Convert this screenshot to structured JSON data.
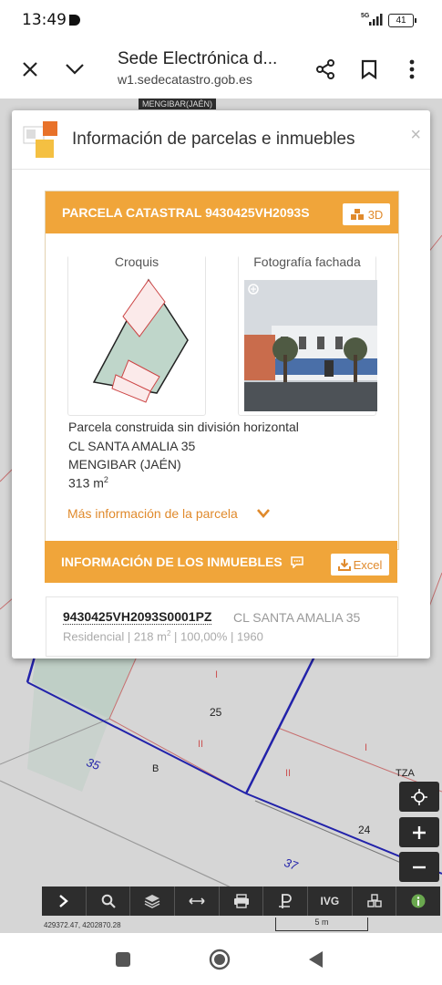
{
  "status_bar": {
    "time": "13:49",
    "network": "5G",
    "battery": "41"
  },
  "browser": {
    "title": "Sede Electrónica d...",
    "url": "w1.sedecatastro.gob.es"
  },
  "map": {
    "municipality": "MENGIBAR(JAÉN)",
    "labels": {
      "l25": "25",
      "l35": "35",
      "lB": "B",
      "lI1": "I",
      "lI2": "I",
      "lII1": "II",
      "lII2": "II",
      "lTZA": "TZA",
      "l24": "24",
      "l37": "37"
    },
    "coordinates": "429372.47, 4202870.28",
    "scale": "5 m",
    "toolbar": {
      "ivg": "IVG"
    }
  },
  "modal": {
    "title": "Información de parcelas e inmuebles",
    "close": "×",
    "parcel": {
      "header": "PARCELA CATASTRAL 9430425VH2093S",
      "btn_3d": "3D",
      "sketch_label": "Croquis",
      "photo_label": "Fotografía fachada",
      "description": "Parcela construida sin división horizontal",
      "address": "CL SANTA AMALIA 35",
      "city": "MENGIBAR (JAÉN)",
      "area": "313 m",
      "area_sup": "2",
      "more_info": "Más información de la parcela"
    },
    "properties": {
      "header": "INFORMACIÓN DE LOS INMUEBLES",
      "excel": "Excel",
      "items": [
        {
          "ref": "9430425VH2093S0001PZ",
          "address": "CL SANTA AMALIA 35",
          "use": "Residencial",
          "area": "218 m",
          "area_sup": "2",
          "share": "100,00%",
          "year": "1960"
        }
      ]
    }
  }
}
